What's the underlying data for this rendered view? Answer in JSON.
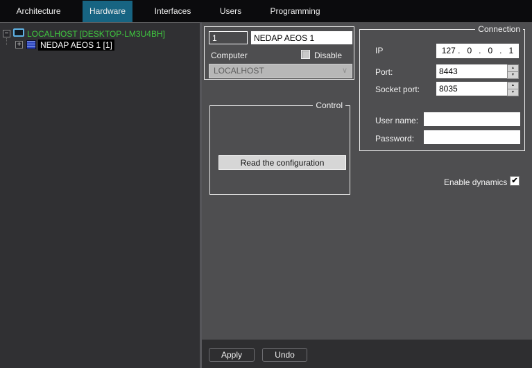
{
  "tabs": [
    {
      "label": "Architecture",
      "active": false
    },
    {
      "label": "Hardware",
      "active": true
    },
    {
      "label": "Interfaces",
      "active": false
    },
    {
      "label": "Users",
      "active": false
    },
    {
      "label": "Programming",
      "active": false
    }
  ],
  "tree": {
    "root_label": "LOCALHOST [DESKTOP-LM3U4BH]",
    "root_expander": "−",
    "child_label": "NEDAP AEOS 1 [1]",
    "child_expander": "+"
  },
  "identity": {
    "id_value": "1",
    "name_value": "NEDAP AEOS 1",
    "computer_label": "Computer",
    "disable_label": "Disable",
    "computer_value": "LOCALHOST"
  },
  "control": {
    "title": "Control",
    "read_button_label": "Read the configuration"
  },
  "connection": {
    "title": "Connection",
    "ip_label": "IP",
    "ip_value": "127 .   0   .   0   .   1",
    "port_label": "Port:",
    "port_value": "8443",
    "socket_port_label": "Socket port:",
    "socket_port_value": "8035",
    "username_label": "User name:",
    "username_value": "",
    "password_label": "Password:",
    "password_value": ""
  },
  "dynamics": {
    "label": "Enable dynamics",
    "checked": true
  },
  "footer": {
    "apply_label": "Apply",
    "undo_label": "Undo"
  },
  "icons": {
    "checkmark": "✔",
    "spinner_up": "▲",
    "spinner_down": "▼",
    "dropdown_chevron": "∨"
  },
  "colors": {
    "active_tab": "#176482",
    "tree_host_green": "#3fc83f",
    "panel_gray": "#4e4e50",
    "dark_panel": "#303033",
    "tab_bar": "#0b0b0d"
  }
}
